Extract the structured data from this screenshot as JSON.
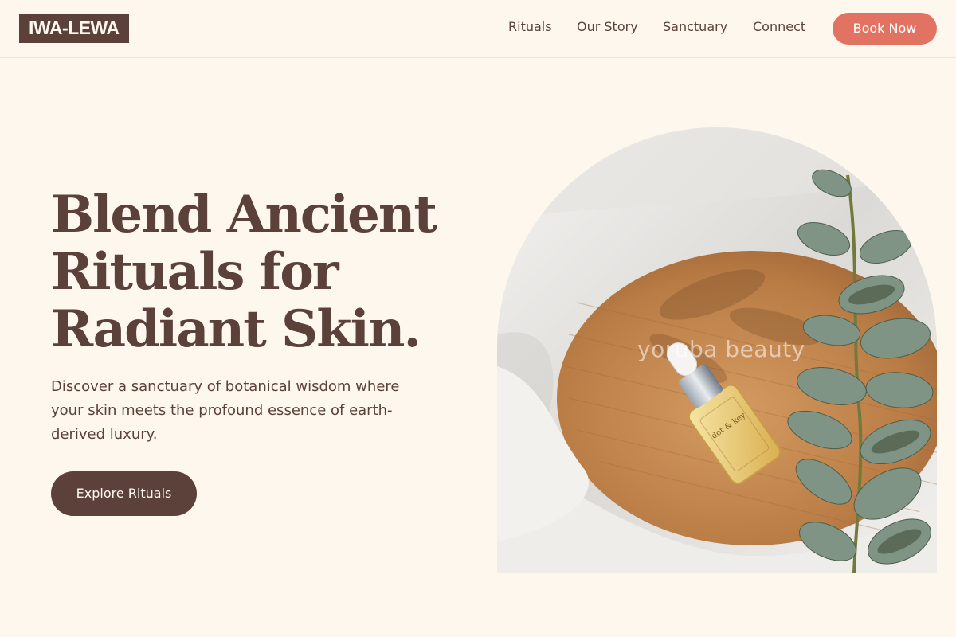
{
  "header": {
    "logo": "IWA-LEWA",
    "nav": [
      "Rituals",
      "Our Story",
      "Sanctuary",
      "Connect"
    ],
    "cta": "Book Now"
  },
  "hero": {
    "title_lines": [
      "Blend Ancient",
      "Rituals for",
      "Radiant Skin."
    ],
    "description": "Discover a sanctuary of botanical wisdom where your skin meets the profound essence of earth-derived luxury.",
    "cta": "Explore Rituals",
    "image": {
      "watermark": "yoruba beauty",
      "bottle_label": "dot & key"
    }
  },
  "colors": {
    "background": "#fdf7ee",
    "brand_dark": "#5b413a",
    "accent": "#e27261"
  }
}
